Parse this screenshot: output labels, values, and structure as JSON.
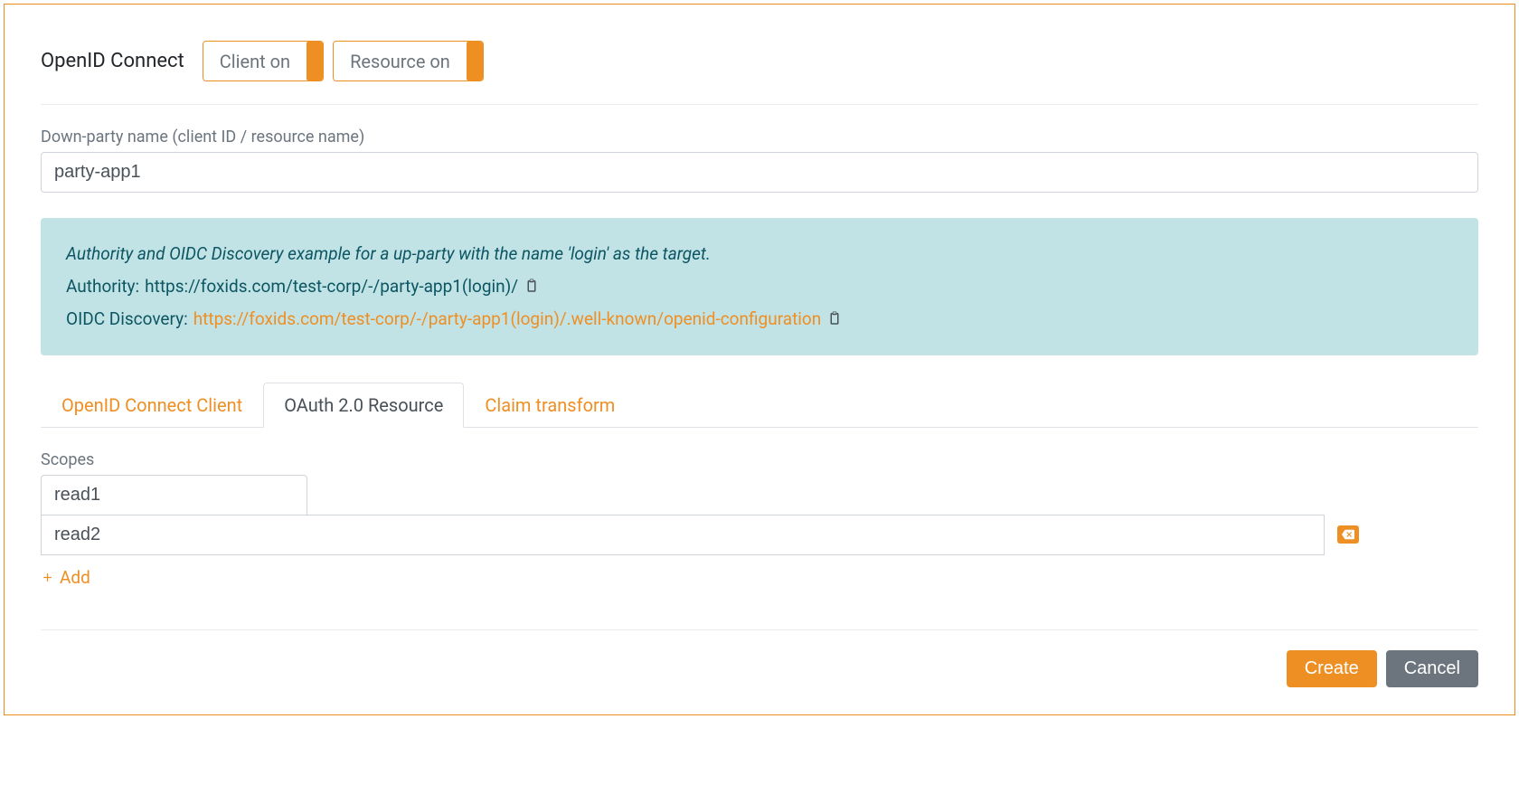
{
  "header": {
    "title": "OpenID Connect",
    "toggles": [
      {
        "label": "Client on"
      },
      {
        "label": "Resource on"
      }
    ]
  },
  "nameField": {
    "label": "Down-party name (client ID / resource name)",
    "value": "party-app1"
  },
  "info": {
    "intro": "Authority and OIDC Discovery example for a up-party with the name 'login' as the target.",
    "authority_label": "Authority:",
    "authority_url": "https://foxids.com/test-corp/-/party-app1(login)/",
    "discovery_label": "OIDC Discovery:",
    "discovery_url": "https://foxids.com/test-corp/-/party-app1(login)/.well-known/openid-configuration"
  },
  "tabs": [
    {
      "label": "OpenID Connect Client",
      "active": false
    },
    {
      "label": "OAuth 2.0 Resource",
      "active": true
    },
    {
      "label": "Claim transform",
      "active": false
    }
  ],
  "scopes": {
    "label": "Scopes",
    "items": [
      "read1",
      "read2"
    ],
    "add_label": "Add"
  },
  "footer": {
    "create": "Create",
    "cancel": "Cancel"
  }
}
